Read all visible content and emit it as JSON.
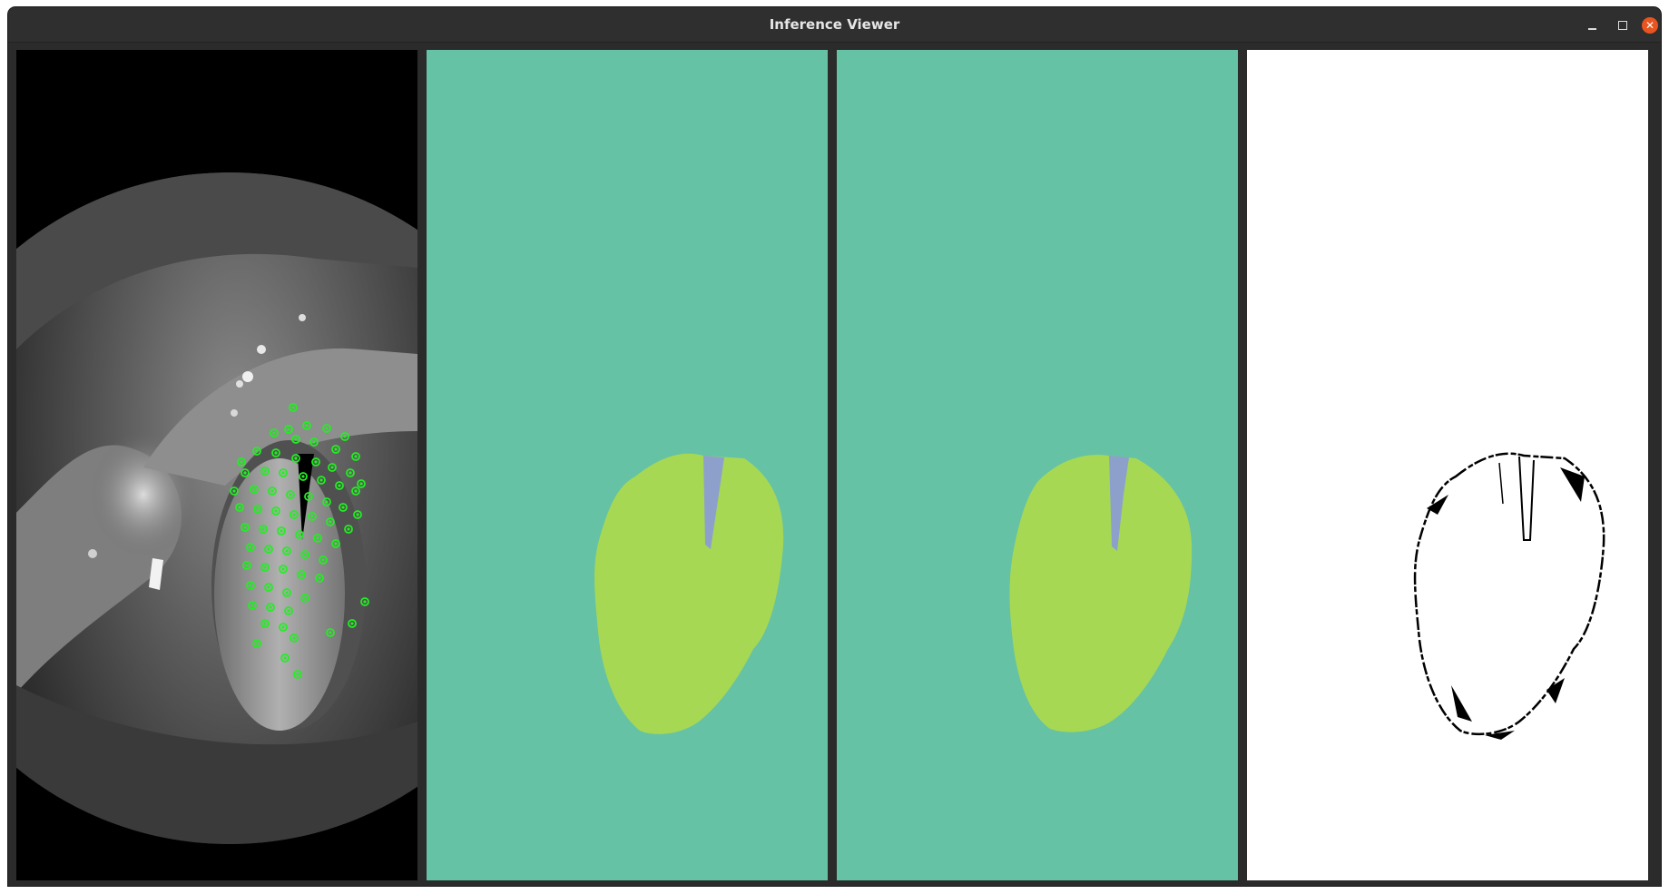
{
  "window": {
    "title": "Inference Viewer",
    "controls": {
      "minimize_icon": "minimize-icon",
      "maximize_icon": "maximize-icon",
      "close_icon": "close-icon"
    }
  },
  "panels": [
    {
      "name": "endoscopy-frame-with-keypoints",
      "content": "grayscale laryngeal endoscopy image with green detected point markers"
    },
    {
      "name": "segmentation-prediction",
      "content": "segmentation map"
    },
    {
      "name": "segmentation-ground-truth",
      "content": "segmentation map"
    },
    {
      "name": "difference-map",
      "content": "binary difference outline"
    }
  ],
  "colors": {
    "background_class": "#66c2a5",
    "vocal_fold_class": "#a6d854",
    "glottis_class": "#8da0cb",
    "keypoint": "#22ee22",
    "titlebar": "#2f2f2f",
    "close_button": "#e95420"
  }
}
